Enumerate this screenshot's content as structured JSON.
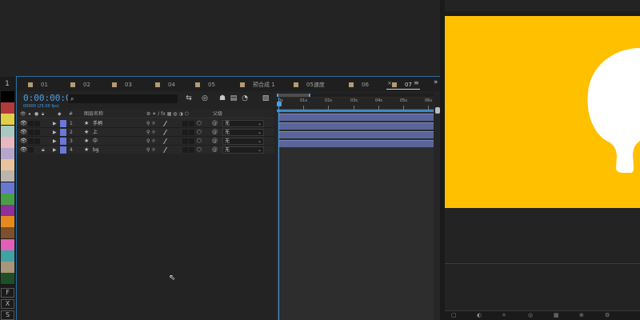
{
  "timeline": {
    "tabs": [
      {
        "label": "01"
      },
      {
        "label": "02"
      },
      {
        "label": "03"
      },
      {
        "label": "04"
      },
      {
        "label": "05"
      },
      {
        "label": "预合成 1"
      },
      {
        "label": "05速度"
      },
      {
        "label": "06"
      },
      {
        "label": "07",
        "active": true
      }
    ],
    "close_label": "×",
    "menu_label": "≡",
    "overflow_label": "»",
    "timecode": "0:00:00:00",
    "fps_label": "00000 (25.00 fps)",
    "search": {
      "placeholder": "",
      "icon": "search-icon"
    },
    "column_headers": {
      "number": "#",
      "layer_name": "图层名称",
      "parent": "父级"
    },
    "layers": [
      {
        "num": "1",
        "name": "手柄",
        "parent": "无"
      },
      {
        "num": "2",
        "name": "上",
        "parent": "无"
      },
      {
        "num": "3",
        "name": "中",
        "parent": "无"
      },
      {
        "num": "4",
        "name": "bg",
        "parent": "无",
        "locked": true
      }
    ],
    "ruler_ticks": [
      "0s",
      "01s",
      "02s",
      "03s",
      "04s",
      "05s",
      "06s"
    ],
    "layer_color": "#6a78d6",
    "bar_color": "#5a6599",
    "accent_color": "#4a9fe8"
  },
  "swatch_panel": {
    "top_label": "1",
    "colors": [
      "#000000",
      "#b33a3a",
      "#e0cf4a",
      "#a7c9c1",
      "#e8b8c0",
      "#b7a6cc",
      "#e8c39d",
      "#bcb5ae",
      "#6778d0",
      "#46a046",
      "#8e2f9a",
      "#e68a1e",
      "#7d4f2a",
      "#e060b8",
      "#3ea3a3",
      "#a8967a",
      "#1f4f26"
    ],
    "letters": [
      "F",
      "X",
      "S"
    ]
  },
  "viewer": {
    "comp_background": "#ffc000",
    "shape_color": "#ffffff"
  }
}
